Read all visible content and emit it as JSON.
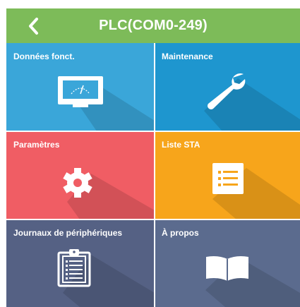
{
  "header": {
    "title": "PLC(COM0-249)",
    "back_icon": "chevron-left-icon",
    "color": "#7dbb59"
  },
  "tiles": [
    {
      "label": "Données fonct.",
      "icon": "meter-icon",
      "color": "#3aa6d9"
    },
    {
      "label": "Maintenance",
      "icon": "wrench-icon",
      "color": "#1e96cf"
    },
    {
      "label": "Paramètres",
      "icon": "gear-icon",
      "color": "#f05d64"
    },
    {
      "label": "Liste STA",
      "icon": "list-icon",
      "color": "#f7a51b"
    },
    {
      "label": "Journaux de périphériques",
      "icon": "clipboard-icon",
      "color": "#556184"
    },
    {
      "label": "À propos",
      "icon": "book-icon",
      "color": "#5b6b8e"
    }
  ]
}
